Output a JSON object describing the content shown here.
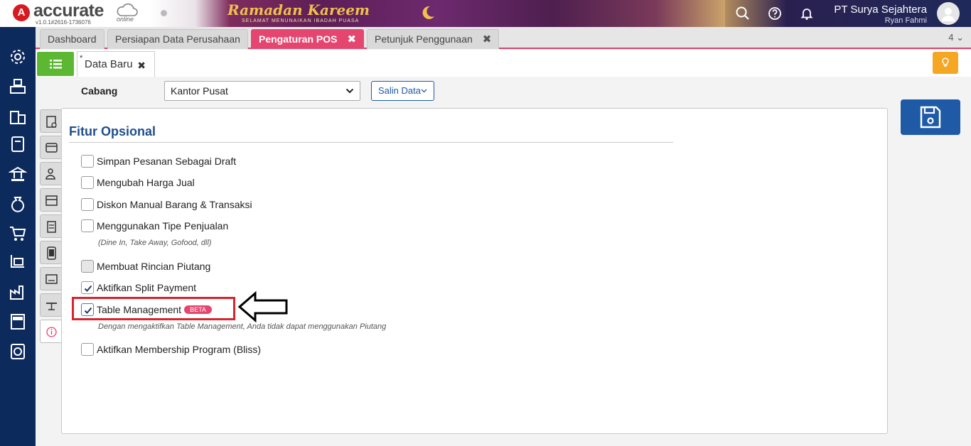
{
  "app": {
    "logo_letter": "A",
    "logo_text": "accurate",
    "logo_online": "online",
    "version": "v1.0.1#2616-1736076"
  },
  "banner": {
    "title": "Ramadan Kareem",
    "subtitle": "SELAMAT MENUNAIKAN IBADAH PUASA"
  },
  "header": {
    "company": "PT Surya Sejahtera",
    "user": "Ryan Fahmi"
  },
  "sidebar": {
    "icons": [
      "gear-icon",
      "cashier-icon",
      "building-icon",
      "ledger-icon",
      "bank-icon",
      "money-bag-icon",
      "cart-icon",
      "trolley-icon",
      "factory-icon",
      "tax-icon",
      "report-icon"
    ]
  },
  "tabs": [
    {
      "label": "Dashboard",
      "closable": false,
      "active": false
    },
    {
      "label": "Persiapan Data Perusahaan",
      "closable": false,
      "active": false
    },
    {
      "label": "Pengaturan POS",
      "closable": true,
      "active": true
    },
    {
      "label": "Petunjuk Penggunaan",
      "closable": true,
      "active": false
    }
  ],
  "tab_close_glyph": "✖",
  "tab_count": "4 ⌄",
  "subtab": {
    "star": "*",
    "label": "Data Baru",
    "close": "✖"
  },
  "form": {
    "cabang_label": "Cabang",
    "cabang_value": "Kantor Pusat",
    "salin_label": "Salin Data"
  },
  "panel": {
    "title": "Fitur Opsional",
    "options": [
      {
        "label": "Simpan Pesanan Sebagai Draft",
        "checked": false
      },
      {
        "label": "Mengubah Harga Jual",
        "checked": false
      },
      {
        "label": "Diskon Manual Barang & Transaksi",
        "checked": false
      },
      {
        "label": "Menggunakan Tipe Penjualan",
        "checked": false
      },
      {
        "label": "Membuat Rincian Piutang",
        "checked": false,
        "disabled": true
      },
      {
        "label": "Aktifkan Split Payment",
        "checked": true
      },
      {
        "label": "Table Management",
        "checked": true,
        "badge": "BETA"
      },
      {
        "label": "Aktifkan Membership Program (Bliss)",
        "checked": false
      }
    ],
    "note_tipe": "(Dine In, Take Away, Gofood, dll)",
    "note_table": "Dengan mengaktifkan Table Management, Anda tidak dapat menggunakan Piutang"
  },
  "colors": {
    "accent": "#e5466f",
    "sidebar": "#0d2a5c",
    "primary": "#1f5aa6",
    "green": "#5cb832",
    "highlight": "#d9232d"
  }
}
